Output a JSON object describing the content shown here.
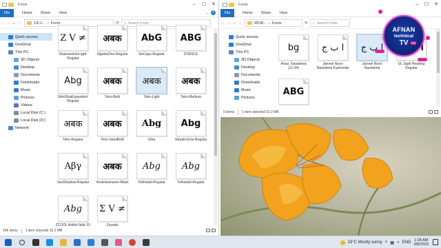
{
  "left_window": {
    "title": "Fonts",
    "window_controls": [
      "–",
      "☐",
      "✕"
    ],
    "ribbon": {
      "file": "File",
      "tabs": [
        "Home",
        "Share",
        "View"
      ],
      "help": "?"
    },
    "address": {
      "crumb1": "1/6.1...",
      "crumb2": "Fonts",
      "search_placeholder": "Search Fonts"
    },
    "nav": [
      {
        "label": "Quick access",
        "icon": "star-icon",
        "color": "#2b7cd3",
        "level": 0,
        "selected": true
      },
      {
        "label": "OneDrive",
        "icon": "cloud-icon",
        "color": "#2b7cd3",
        "level": 0
      },
      {
        "label": "This PC",
        "icon": "computer-icon",
        "color": "#5a87b8",
        "level": 0
      },
      {
        "label": "3D Objects",
        "icon": "cube-icon",
        "color": "#56a8e8",
        "level": 1
      },
      {
        "label": "Desktop",
        "icon": "desktop-icon",
        "color": "#3f8fd6",
        "level": 1
      },
      {
        "label": "Documents",
        "icon": "documents-icon",
        "color": "#8a9bb0",
        "level": 1
      },
      {
        "label": "Downloads",
        "icon": "download-icon",
        "color": "#2b7cd3",
        "level": 1
      },
      {
        "label": "Music",
        "icon": "music-icon",
        "color": "#2b7cd3",
        "level": 1
      },
      {
        "label": "Pictures",
        "icon": "pictures-icon",
        "color": "#5aa0d8",
        "level": 1
      },
      {
        "label": "Videos",
        "icon": "videos-icon",
        "color": "#6a6ad0",
        "level": 1
      },
      {
        "label": "Local Disk (C:)",
        "icon": "drive-icon",
        "color": "#7f8a96",
        "level": 1
      },
      {
        "label": "Local Disk (D:)",
        "icon": "drive-icon",
        "color": "#7f8a96",
        "level": 1
      },
      {
        "label": "Network",
        "icon": "network-icon",
        "color": "#4d87c7",
        "level": 0
      }
    ],
    "tiles": [
      {
        "sample": "Z V ≠",
        "label": "ShadowsIntoLight-Regular",
        "style": "serif"
      },
      {
        "sample": "अबक",
        "label": "SignikaOne-Regular",
        "style": "bold"
      },
      {
        "sample": "AbG",
        "label": "SixCaps-Regular",
        "style": "bold"
      },
      {
        "sample": "ABG",
        "label": "STENCIL",
        "style": "bold"
      },
      {
        "sample": "Abg",
        "label": "StintUltraExpanded-Regular",
        "style": "plain"
      },
      {
        "sample": "अबक",
        "label": "Teko-Bold",
        "style": "bold"
      },
      {
        "sample": "अबक",
        "label": "Teko-Light",
        "style": "plain",
        "selected": true
      },
      {
        "sample": "अबक",
        "label": "Teko-Medium",
        "style": "bold"
      },
      {
        "sample": "अबक",
        "label": "Teko-Regular",
        "style": "plain"
      },
      {
        "sample": "अबक",
        "label": "Teko-SemiBold",
        "style": "bold"
      },
      {
        "sample": "Abg",
        "label": "Ultra",
        "style": "bold serif"
      },
      {
        "sample": "Abg",
        "label": "VampiroOne-Regular",
        "style": "bold"
      },
      {
        "sample": "Aβγ",
        "label": "VastShadow-Regular",
        "style": "serif"
      },
      {
        "sample": "अबक",
        "label": "Vesterkamaree-Black",
        "style": "bold"
      },
      {
        "sample": "Abg",
        "label": "Yellowtail-Regular",
        "style": "ital"
      },
      {
        "sample": "Abg",
        "label": "Yellowtail-Regular",
        "style": "ital"
      },
      {
        "sample": "Abg",
        "label": "ZCOOL Addict Italic 01",
        "style": "ital"
      },
      {
        "sample": "Σ V ≠",
        "label": "Zeyada",
        "style": "serif"
      }
    ],
    "status": {
      "count": "246 items",
      "selected": "1 item selected 10.2 MB"
    }
  },
  "right_window": {
    "title": "Fonts",
    "window_controls": [
      "–",
      "☐",
      "✕"
    ],
    "ribbon": {
      "file": "File",
      "tabs": [
        "Home",
        "Share",
        "View"
      ],
      "help": "?"
    },
    "address": {
      "crumb1": "WOR...",
      "crumb2": "Fonts",
      "search_placeholder": "Search Fonts"
    },
    "nav": [
      {
        "label": "Quick access",
        "icon": "star-icon",
        "color": "#2b7cd3",
        "level": 0
      },
      {
        "label": "OneDrive",
        "icon": "cloud-icon",
        "color": "#2b7cd3",
        "level": 0
      },
      {
        "label": "This PC",
        "icon": "computer-icon",
        "color": "#5a87b8",
        "level": 0
      },
      {
        "label": "3D Objects",
        "icon": "cube-icon",
        "color": "#56a8e8",
        "level": 1
      },
      {
        "label": "Desktop",
        "icon": "desktop-icon",
        "color": "#3f8fd6",
        "level": 1
      },
      {
        "label": "Documents",
        "icon": "documents-icon",
        "color": "#8a9bb0",
        "level": 1
      },
      {
        "label": "Downloads",
        "icon": "download-icon",
        "color": "#2b7cd3",
        "level": 1
      },
      {
        "label": "Music",
        "icon": "music-icon",
        "color": "#2b7cd3",
        "level": 1
      },
      {
        "label": "Pictures",
        "icon": "pictures-icon",
        "color": "#5aa0d8",
        "level": 1
      }
    ],
    "tiles": [
      {
        "sample": "bg",
        "label": "Amar_Nastaleeq (v1.04)",
        "style": "plain"
      },
      {
        "sample": "ا ب ج",
        "label": "Jameel Noori Nastaleeq Kasheeda",
        "style": "serif"
      },
      {
        "sample": "ا ب ج",
        "label": "Jameel Noori Nastaleeq",
        "style": "serif",
        "selected": true
      },
      {
        "sample": "ا ب ج",
        "label": "UL Sajid Heading Regular",
        "style": "bold"
      },
      {
        "sample": "ABG",
        "label": "",
        "style": "bold"
      }
    ],
    "status": {
      "count": "5 items",
      "selected": "1 item selected 10.2 MB"
    }
  },
  "badge": {
    "line1": "AFNAN",
    "line2": "technical",
    "line3": "TV",
    "hd": "HD"
  },
  "taskbar": {
    "apps": [
      "windows-start-icon",
      "search-icon",
      "task-view-icon",
      "edge-icon",
      "file-explorer-icon",
      "store-icon",
      "mail-icon",
      "app-icon-1",
      "app-icon-2",
      "chrome-icon",
      "app-icon-3"
    ],
    "weather": "23°C  Mostly sunny",
    "lang": "ENG",
    "time": "1:28 AM",
    "date": "5/8/2023"
  }
}
